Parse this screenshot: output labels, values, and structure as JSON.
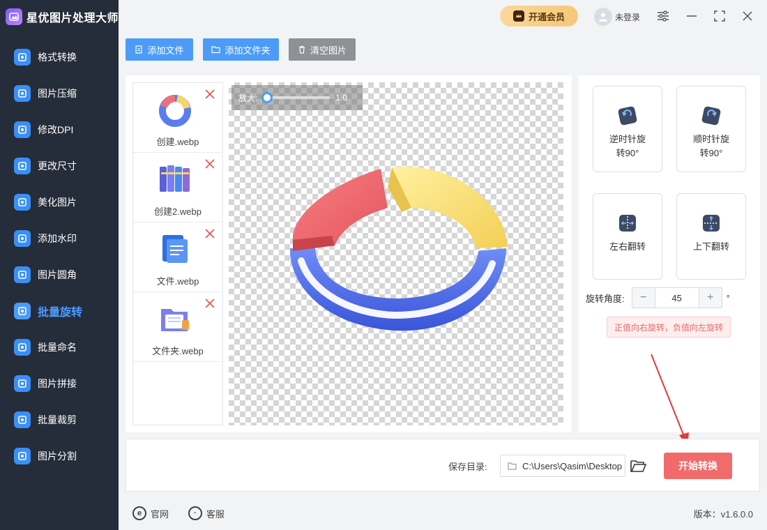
{
  "app": {
    "title": "星优图片处理大师"
  },
  "topbar": {
    "vip_label": "开通会员",
    "user_label": "未登录"
  },
  "sidebar": {
    "items": [
      {
        "label": "格式转换",
        "icon": "image-format-icon",
        "color": "#3a8ff7"
      },
      {
        "label": "图片压缩",
        "icon": "compress-icon",
        "color": "#3a8ff7"
      },
      {
        "label": "修改DPI",
        "icon": "dpi-icon",
        "color": "#3a8ff7"
      },
      {
        "label": "更改尺寸",
        "icon": "resize-icon",
        "color": "#3a8ff7"
      },
      {
        "label": "美化图片",
        "icon": "beautify-icon",
        "color": "#3a8ff7"
      },
      {
        "label": "添加水印",
        "icon": "watermark-icon",
        "color": "#3a8ff7"
      },
      {
        "label": "图片圆角",
        "icon": "round-corner-icon",
        "color": "#3a8ff7"
      },
      {
        "label": "批量旋转",
        "icon": "rotate-icon",
        "color": "#4b9bff",
        "active": true
      },
      {
        "label": "批量命名",
        "icon": "rename-icon",
        "color": "#3a8ff7"
      },
      {
        "label": "图片拼接",
        "icon": "collage-icon",
        "color": "#3a8ff7"
      },
      {
        "label": "批量裁剪",
        "icon": "crop-icon",
        "color": "#3a8ff7"
      },
      {
        "label": "图片分割",
        "icon": "split-icon",
        "color": "#3a8ff7"
      }
    ]
  },
  "toolbar": {
    "add_file": "添加文件",
    "add_folder": "添加文件夹",
    "clear": "清空图片"
  },
  "files": [
    {
      "name": "创建.webp",
      "thumb": "chart-ring-thumb"
    },
    {
      "name": "创建2.webp",
      "thumb": "books-thumb"
    },
    {
      "name": "文件.webp",
      "thumb": "document-thumb"
    },
    {
      "name": "文件夹.webp",
      "thumb": "folder-thumb"
    }
  ],
  "preview": {
    "zoom_label": "放大:",
    "zoom_value": "1.0",
    "zoom_fraction": 0.0
  },
  "operations": {
    "ccw": "逆时针旋\n转90°",
    "cw": "顺时针旋\n转90°",
    "flip_h": "左右翻转",
    "flip_v": "上下翻转"
  },
  "angle": {
    "label": "旋转角度:",
    "value": "45",
    "unit": "°",
    "minus": "−",
    "plus": "+"
  },
  "hint": "正值向右旋转，负值向左旋转",
  "save": {
    "label": "保存目录:",
    "path": "C:\\Users\\Qasim\\Desktop"
  },
  "start_button": "开始转换",
  "footer": {
    "website": "官网",
    "service": "客服",
    "version": "版本：v1.6.0.0"
  },
  "colors": {
    "accent": "#4c9cf7",
    "start": "#f16b6b",
    "sidebar": "#252d3a"
  }
}
